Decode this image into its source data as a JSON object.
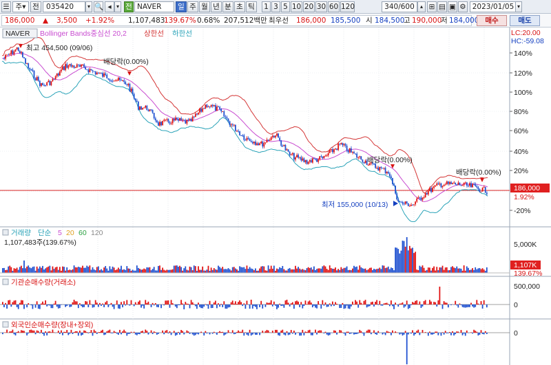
{
  "toolbar": {
    "period_unit": "주",
    "market_btn": "전",
    "code": "035420",
    "name_badge": "전",
    "name": "NAVER",
    "periods": [
      "일",
      "주",
      "월",
      "년",
      "분",
      "초",
      "틱"
    ],
    "active_period": "일",
    "intervals": [
      "1",
      "3",
      "5",
      "10",
      "20",
      "30",
      "60",
      "120"
    ],
    "count": "340",
    "count_total": "/600",
    "date": "2023/01/05",
    "buy_label": "매수",
    "sell_label": "매도"
  },
  "quote": {
    "price": "186,000",
    "change": "3,500",
    "change_pct": "+1.92%",
    "volume": "1,107,483",
    "volume_pct": "139.67%",
    "turnover_pct": "0.68%",
    "amount": "207,512백만",
    "best_ask_label": "최우선",
    "best_ask": "186,000",
    "best_bid": "185,500",
    "open_label": "시",
    "open": "184,500",
    "high_label": "고",
    "high": "190,000",
    "low_label": "저",
    "low": "184,000"
  },
  "colors": {
    "up": "#e01010",
    "down": "#1d4fd0",
    "upper_band": "#d43535",
    "mid_band": "#c84bd0",
    "lower_band": "#2aa3b8",
    "price_line": "#d82020"
  },
  "price_panel": {
    "symbol": "NAVER",
    "legend": "Bollinger Bands중심선 20,2",
    "legend_upper": "상한선",
    "legend_lower": "하한선",
    "lc": "LC:20.00",
    "hc": "HC:-59.08",
    "y_ticks": [
      "140%",
      "120%",
      "100%",
      "80%",
      "60%",
      "40%",
      "20%",
      "-20%"
    ],
    "current_price_tag": "186,000",
    "current_change_tag": "1.92%",
    "max_label": "최고 454,500 (09/06)",
    "min_label": "최저 155,000 (10/13)",
    "dividend_label": "배당락(0.00%)"
  },
  "volume_panel": {
    "title": "거래량",
    "ma_label": "단순",
    "ma_periods": [
      "5",
      "20",
      "60",
      "120"
    ],
    "value_label": "1,107,483주(139.67%)",
    "y_tick": "5,000K",
    "tag_value": "1,107K",
    "tag_pct": "139.67%"
  },
  "inst_panel": {
    "title": "기관순매수량(거래소)",
    "y_ticks": [
      "500,000",
      "0"
    ]
  },
  "foreign_panel": {
    "title": "외국인순매수량(장내+장외)",
    "y_tick": "0"
  }
}
